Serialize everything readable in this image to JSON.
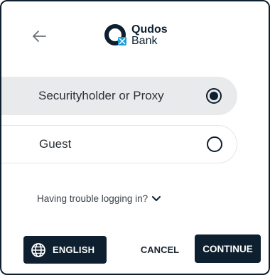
{
  "brand": {
    "name": "Qudos",
    "sub": "Bank",
    "primary_color": "#0e1f2f",
    "accent_color": "#1b9bd8",
    "logo_icon": "qudos-bank-logo"
  },
  "header": {
    "back_icon": "arrow-left-icon"
  },
  "options": [
    {
      "label": "Securityholder or Proxy",
      "selected": true
    },
    {
      "label": "Guest",
      "selected": false
    }
  ],
  "help": {
    "label": "Having trouble logging in?",
    "icon": "chevron-down-icon"
  },
  "footer": {
    "language_label": "ENGLISH",
    "language_icon": "globe-icon",
    "cancel_label": "CANCEL",
    "continue_label": "CONTINUE"
  }
}
